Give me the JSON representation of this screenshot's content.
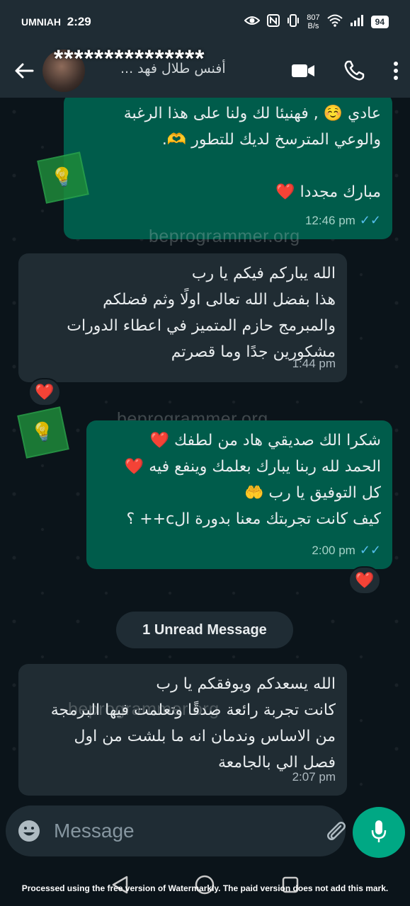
{
  "status_bar": {
    "carrier": "UMNIAH",
    "time": "2:29",
    "net_speed": "807\nB/s",
    "battery": "94"
  },
  "header": {
    "contact_name": "***************",
    "contact_sub": "أفنس طلال فهد ..."
  },
  "messages": [
    {
      "direction": "out",
      "lines": [
        "عادي ☺️ , فهنيئا لك ولنا على هذا الرغبة",
        "والوعي المترسخ لديك للتطور 🫶.",
        "",
        "مبارك مجددا ❤️"
      ],
      "time": "12:46 pm",
      "ticks": "✓✓"
    },
    {
      "direction": "in",
      "lines": [
        "الله يباركم فيكم يا رب",
        "هذا بفضل الله تعالى اولًا وثم فضلكم",
        "والمبرمج حازم المتميز في اعطاء الدورات",
        "مشكورين جدًا وما قصرتم"
      ],
      "time": "1:44 pm",
      "reaction": "❤️"
    },
    {
      "direction": "out",
      "lines": [
        "شكرا الك صديقي هاد من لطفك ❤️",
        "الحمد لله ربنا يبارك بعلمك وينفع فيه ❤️",
        "كل التوفيق يا رب 🤲",
        "كيف كانت تجربتك معنا بدورة الc++ ؟"
      ],
      "time": "2:00 pm",
      "ticks": "✓✓",
      "reaction": "❤️"
    },
    {
      "direction": "in",
      "lines": [
        "الله يسعدكم ويوفقكم يا رب",
        "كانت تجربة رائعة صدقًا وتعلمت فيها البرمجة",
        "من الاساس وندمان انه ما بلشت من اول",
        "فصل الي بالجامعة"
      ],
      "time": "2:07 pm"
    }
  ],
  "unread_label": "1 Unread Message",
  "watermark_text": "beprogrammer.org",
  "composer": {
    "placeholder": "Message"
  },
  "footer_note": "Processed using the free version of Watermarkly. The paid version does not add this mark.",
  "colors": {
    "outgoing_bubble": "#005c4b",
    "incoming_bubble": "#202c33",
    "accent": "#00a884",
    "read_ticks": "#53bdeb"
  }
}
